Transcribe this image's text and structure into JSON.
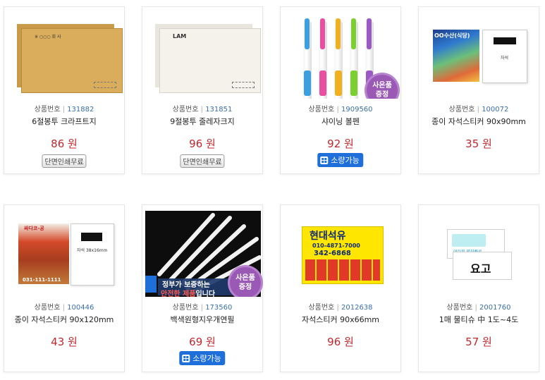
{
  "products": [
    {
      "code_label": "상품번호",
      "code": "131882",
      "name": "6절봉투 크라프트지",
      "price": "86 원",
      "badge_print": "단면인쇄무료"
    },
    {
      "code_label": "상품번호",
      "code": "131851",
      "name": "9절봉투 줄레자크지",
      "price": "96 원",
      "badge_print": "단면인쇄무료"
    },
    {
      "code_label": "상품번호",
      "code": "1909560",
      "name": "샤이닝 볼펜",
      "price": "92 원",
      "badge_small": "소량가능",
      "gift": [
        "사은품",
        "증정"
      ]
    },
    {
      "code_label": "상품번호",
      "code": "100072",
      "name": "종이 자석스티커 90x90mm",
      "price": "35 원"
    },
    {
      "code_label": "상품번호",
      "code": "100446",
      "name": "종이 자석스티커 90x120mm",
      "price": "43 원"
    },
    {
      "code_label": "상품번호",
      "code": "173560",
      "name": "백색원형지우개연필",
      "price": "69 원",
      "badge_small": "소량가능",
      "gift": [
        "사은품",
        "증정"
      ]
    },
    {
      "code_label": "상품번호",
      "code": "2012638",
      "name": "자석스티커 90x66mm",
      "price": "96 원"
    },
    {
      "code_label": "상품번호",
      "code": "2001760",
      "name": "1매 물티슈 中 1도~4도",
      "price": "57 원"
    }
  ],
  "thumbs": {
    "envelope1": {
      "logo": "※ ○○○ 회 사"
    },
    "envelope2": {
      "logo": "LAM"
    },
    "sticker1": {
      "headline": "OO수산(식당)",
      "magnet_label": "자석"
    },
    "sticker2": {
      "headline": "싸다코-공",
      "phone": "031-111-1111",
      "magnet_label": "자석 38x16mm"
    },
    "pencil": {
      "caption_1": "정부가 보증하는",
      "caption_2": "안전한 제품",
      "caption_3": "입니다"
    },
    "sticker3": {
      "title": "현대석유",
      "phone_1": "010-4871-7000",
      "phone_2": "342-6868"
    },
    "tissue": {
      "text_1": "여러분 평화빠르",
      "text_2": "요고"
    }
  }
}
